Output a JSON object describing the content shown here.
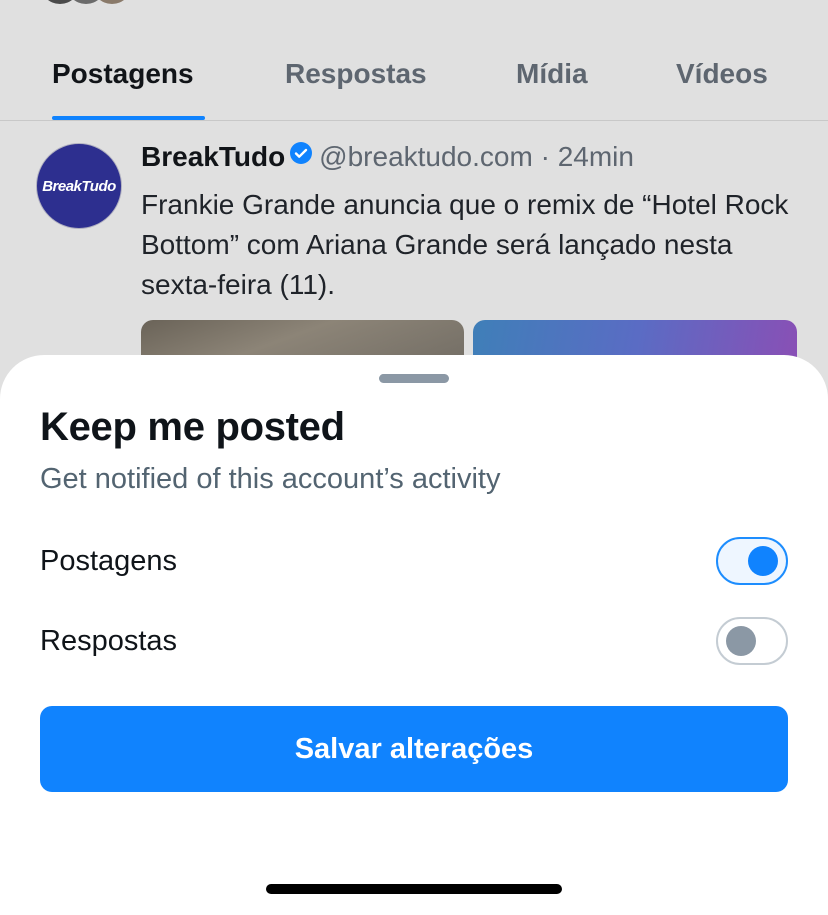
{
  "profile": {
    "tabs": [
      {
        "label": "Postagens",
        "active": true
      },
      {
        "label": "Respostas",
        "active": false
      },
      {
        "label": "Mídia",
        "active": false
      },
      {
        "label": "Vídeos",
        "active": false
      }
    ],
    "post": {
      "avatar_text": "BreakTudo",
      "author": "BreakTudo",
      "verified_icon": "verified-badge-icon",
      "handle": "@breaktudo.com · 24min",
      "text": "Frankie Grande anuncia que o remix de “Hotel Rock Bottom” com Ariana Grande será lançado nesta sexta-feira (11)."
    }
  },
  "sheet": {
    "title": "Keep me posted",
    "subtitle": "Get notified of this account’s activity",
    "options": [
      {
        "label": "Postagens",
        "enabled": true
      },
      {
        "label": "Respostas",
        "enabled": false
      }
    ],
    "save_label": "Salvar alterações"
  },
  "colors": {
    "accent": "#1083fe",
    "background_dim": "#e0e0e0",
    "sheet_bg": "#ffffff"
  }
}
